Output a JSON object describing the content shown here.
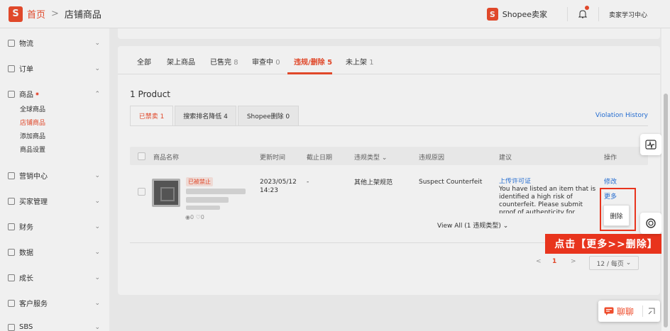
{
  "topbar": {
    "logo": "S",
    "home": "首页",
    "separator": ">",
    "current": "店铺商品",
    "seller_brand": "Shopee卖家",
    "learn": "卖家学习中心"
  },
  "sidebar": {
    "items": [
      {
        "label": "物流",
        "icon": "truck-icon"
      },
      {
        "label": "订单",
        "icon": "order-icon"
      },
      {
        "label": "商品",
        "icon": "product-icon"
      },
      {
        "label": "营销中心",
        "icon": "tag-icon"
      },
      {
        "label": "买家管理",
        "icon": "user-icon"
      },
      {
        "label": "财务",
        "icon": "wallet-icon"
      },
      {
        "label": "数据",
        "icon": "chart-icon"
      },
      {
        "label": "成长",
        "icon": "growth-icon"
      },
      {
        "label": "客户服务",
        "icon": "service-icon"
      },
      {
        "label": "SBS",
        "icon": "sbs-icon"
      }
    ],
    "subitems": [
      "全球商品",
      "店铺商品",
      "添加商品",
      "商品设置"
    ],
    "active_sub": "店铺商品"
  },
  "tabs": [
    {
      "label": "全部",
      "count": ""
    },
    {
      "label": "架上商品",
      "count": ""
    },
    {
      "label": "已售完",
      "count": "8"
    },
    {
      "label": "审查中",
      "count": "0"
    },
    {
      "label": "违规/删除",
      "count": "5"
    },
    {
      "label": "未上架",
      "count": "1"
    }
  ],
  "product_count": "1 Product",
  "subtabs": [
    {
      "label": "已禁卖 1"
    },
    {
      "label": "搜索排名降低 4"
    },
    {
      "label": "Shopee删除 0"
    }
  ],
  "violation_history": "Violation History",
  "table": {
    "headers": [
      "商品名称",
      "更新时间",
      "截止日期",
      "违规类型",
      "违规原因",
      "建议",
      "操作"
    ],
    "row": {
      "status": "已被禁止",
      "views": "◉0  ♡0",
      "updated_date": "2023/05/12",
      "updated_time": "14:23",
      "deadline": "-",
      "violation_type": "其他上架规范",
      "violation_reason": "Suspect Counterfeit",
      "suggestion_link": "上传许可证",
      "suggestion_text": "You have listed an item that is identified a high risk of counterfeit. Please submit proof of authenticity for validation via",
      "op_edit": "修改",
      "op_more": "更多",
      "op_delete": "删除"
    },
    "view_all": "View All (1 违规类型)"
  },
  "pager": {
    "prev": "<",
    "page": "1",
    "next": ">",
    "page_size": "12 / 每页"
  },
  "callout": "点击【更多>>删除】",
  "chat": {
    "label": "聊聊"
  },
  "colors": {
    "brand": "#ee4d2d",
    "link": "#2673dd",
    "callout": "#e8341d"
  }
}
